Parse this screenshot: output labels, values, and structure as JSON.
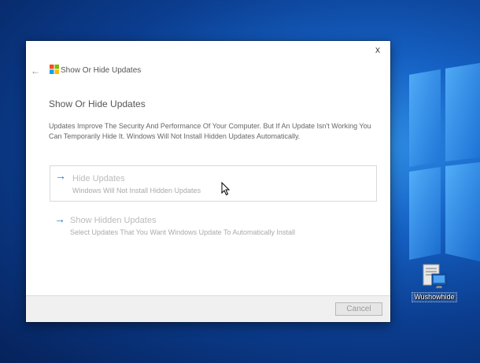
{
  "desktop": {
    "background_colors": [
      "#06225a",
      "#1561c4",
      "#2f8fe6"
    ],
    "icon": {
      "label": "Wushowhide",
      "icon_name": "troubleshooter-icon"
    }
  },
  "dialog": {
    "close_label": "x",
    "back_icon": "arrow-left-icon",
    "app_icon": "windows-logo-icon",
    "app_title": "Show Or Hide Updates",
    "heading": "Show Or Hide Updates",
    "description": "Updates Improve The Security And Performance Of Your Computer. But If An Update Isn't Working You Can Temporarily Hide It. Windows Will Not Install Hidden Updates Automatically.",
    "options": [
      {
        "title": "Hide Updates",
        "subtitle": "Windows Will Not Install Hidden Updates",
        "icon": "arrow-right-icon"
      },
      {
        "title": "Show Hidden Updates",
        "subtitle": "Select Updates That You Want Windows Update To Automatically Install",
        "icon": "arrow-right-icon"
      }
    ],
    "cancel_label": "Cancel",
    "accent_color": "#2a6fc9"
  }
}
